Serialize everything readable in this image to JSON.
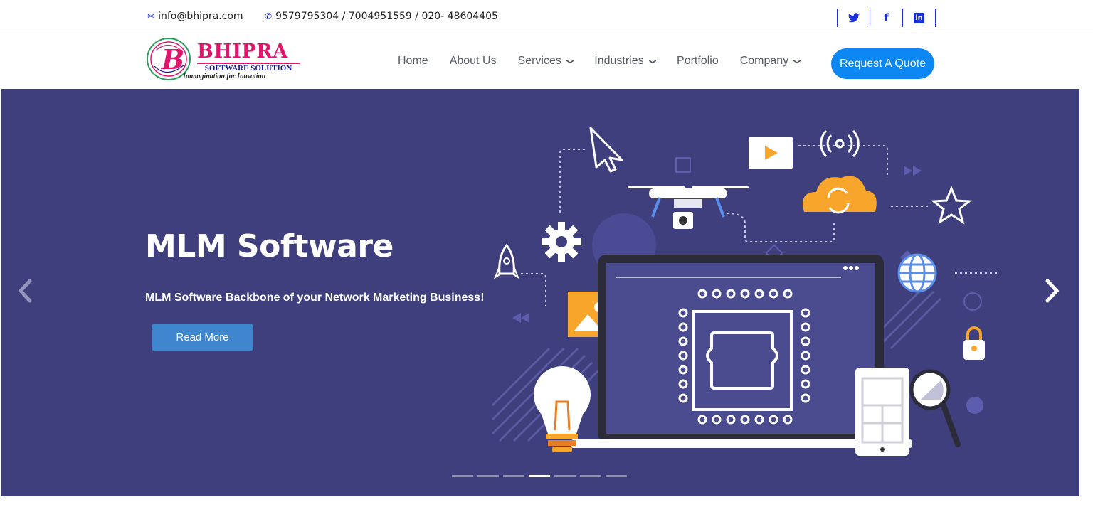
{
  "topbar": {
    "email": "info@bhipra.com",
    "phone": "9579795304 / 7004951559 / 020- 48604405",
    "social": [
      {
        "icon": "twitter-icon",
        "glyph": "🐦"
      },
      {
        "icon": "facebook-icon",
        "glyph": "f"
      },
      {
        "icon": "linkedin-icon",
        "glyph": "in"
      }
    ]
  },
  "logo": {
    "name": "BHIPRA",
    "subtitle": "SOFTWARE SOLUTION",
    "tagline": "Immagination for Inovation",
    "letter": "B"
  },
  "nav": {
    "items": [
      {
        "label": "Home",
        "dropdown": false
      },
      {
        "label": "About Us",
        "dropdown": false
      },
      {
        "label": "Services",
        "dropdown": true
      },
      {
        "label": "Industries",
        "dropdown": true
      },
      {
        "label": "Portfolio",
        "dropdown": false
      },
      {
        "label": "Company",
        "dropdown": true
      }
    ],
    "cta": "Request A Quote"
  },
  "hero": {
    "title": "MLM Software",
    "subtitle": "MLM Software Backbone of your Network Marketing Business!",
    "button": "Read More",
    "prev": "‹",
    "next": "›",
    "slide_count": 7,
    "active_slide": 4
  },
  "colors": {
    "hero_bg": "#3f3f7d",
    "accent": "#0d87f2",
    "brand_pink": "#e0166b",
    "brand_blue": "#1a2fd6",
    "illustration_orange": "#f7a52b"
  }
}
